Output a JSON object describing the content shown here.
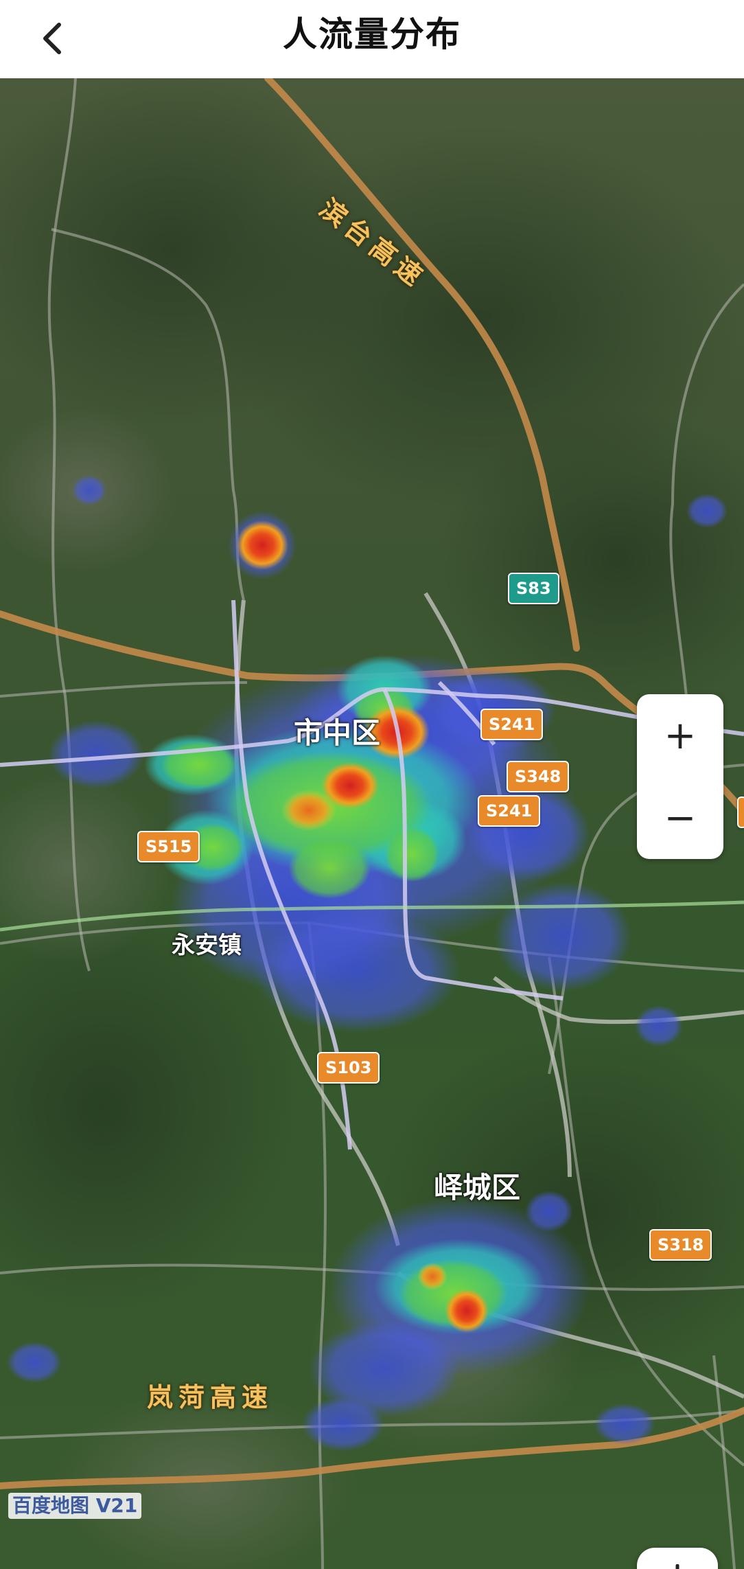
{
  "header": {
    "title": "人流量分布"
  },
  "map": {
    "place_labels": {
      "shizhong": "市中区",
      "yongan": "永安镇",
      "yicheng": "峄城区"
    },
    "highway_labels": {
      "zaotai": "滨台高速",
      "lanhe": "岚菏高速"
    },
    "road_shields": {
      "s83": "S83",
      "s241_a": "S241",
      "s348": "S348",
      "s241_b": "S241",
      "s515": "S515",
      "s103": "S103",
      "s318": "S318"
    },
    "shield_colors": {
      "provincial": "#e98a2a",
      "expressway": "#1f9b8c"
    },
    "heatmap_colors": [
      "#3b4fd6",
      "#2fd0b0",
      "#6bd23a",
      "#f0a020",
      "#d42020"
    ],
    "provider_logo": "百度地图 V21"
  },
  "controls": {
    "zoom_in": "+",
    "zoom_out": "−"
  }
}
